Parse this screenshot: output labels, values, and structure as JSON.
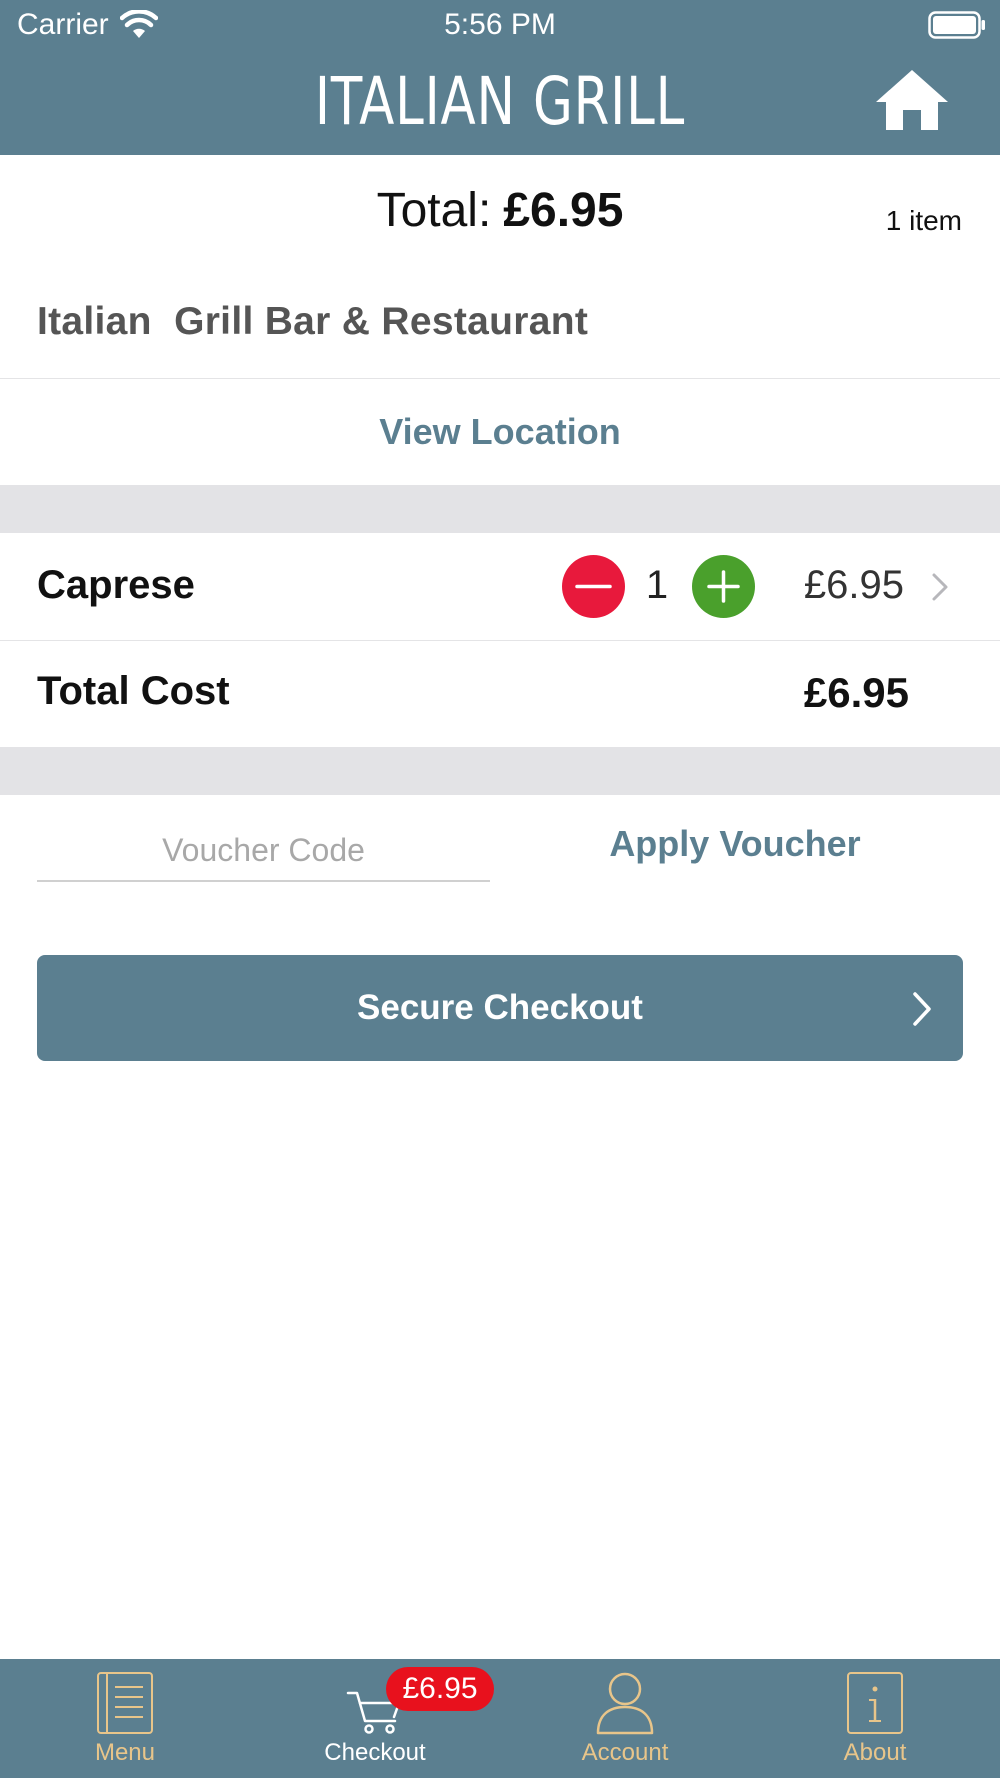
{
  "status_bar": {
    "carrier": "Carrier",
    "time": "5:56 PM",
    "wifi_icon": "wifi-icon",
    "battery_icon": "battery-icon"
  },
  "header": {
    "title": "ITALIAN GRILL",
    "home_icon": "home-icon"
  },
  "summary": {
    "total_label": "Total:",
    "total_value": "£6.95",
    "item_count": "1 item"
  },
  "restaurant": {
    "name": "Italian  Grill Bar & Restaurant",
    "view_location": "View Location"
  },
  "order": {
    "items": [
      {
        "name": "Caprese",
        "quantity": "1",
        "price": "£6.95"
      }
    ],
    "total_cost_label": "Total Cost",
    "total_cost_value": "£6.95"
  },
  "voucher": {
    "placeholder": "Voucher Code",
    "value": "",
    "apply_label": "Apply Voucher"
  },
  "checkout": {
    "label": "Secure Checkout"
  },
  "tab_bar": {
    "tabs": [
      {
        "label": "Menu",
        "icon": "menu-book-icon"
      },
      {
        "label": "Checkout",
        "icon": "cart-icon",
        "badge": "£6.95",
        "active": true
      },
      {
        "label": "Account",
        "icon": "person-icon"
      },
      {
        "label": "About",
        "icon": "info-icon"
      }
    ]
  },
  "colors": {
    "brand": "#5b7f90",
    "minus": "#e8193c",
    "plus": "#4aa02c",
    "tab_inactive": "#e8c58a",
    "badge": "#e8111d"
  }
}
